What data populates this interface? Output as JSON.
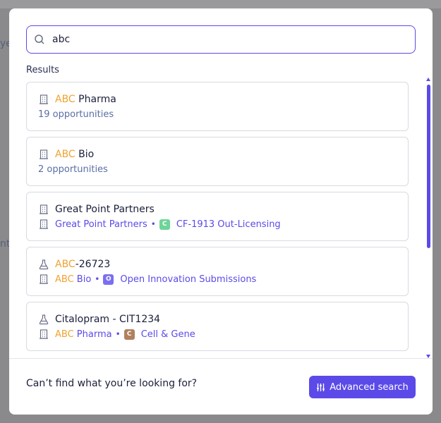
{
  "background": {
    "fragments": [
      "ye",
      "nt"
    ]
  },
  "search": {
    "value": "abc",
    "placeholder": ""
  },
  "results_label": "Results",
  "results": [
    {
      "icon": "building-icon",
      "title_highlight": "ABC",
      "title_rest": " Pharma",
      "subtitle": "19 opportunities"
    },
    {
      "icon": "building-icon",
      "title_highlight": "ABC",
      "title_rest": " Bio",
      "subtitle": "2 opportunities"
    },
    {
      "icon": "building-icon",
      "title": "Great Point Partners",
      "sub_org": "Great Point Partners",
      "badge": "C",
      "badge_color": "#6fd49a",
      "sub_program": "CF-1913 Out-Licensing"
    },
    {
      "icon": "flask-icon",
      "title_highlight": "ABC",
      "title_rest": "-26723",
      "sub_org_highlight": "ABC",
      "sub_org_rest": " Bio",
      "badge": "O",
      "badge_color": "#7b6ff0",
      "sub_program": "Open Innovation Submissions"
    },
    {
      "icon": "flask-icon",
      "title": "Citalopram - CIT1234",
      "sub_org_highlight": "ABC",
      "sub_org_rest": " Pharma",
      "badge": "C",
      "badge_color": "#b08060",
      "sub_program": "Cell & Gene"
    }
  ],
  "footer": {
    "text": "Can’t find what you’re looking for?",
    "button_label": "Advanced search"
  },
  "colors": {
    "accent": "#5b4ae8",
    "highlight": "#f0a232"
  }
}
